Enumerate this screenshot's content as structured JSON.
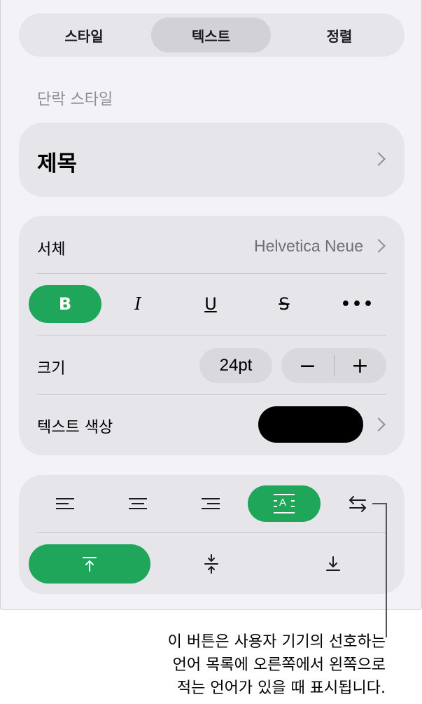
{
  "tabs": [
    {
      "label": "스타일",
      "active": false
    },
    {
      "label": "텍스트",
      "active": true
    },
    {
      "label": "정렬",
      "active": false
    }
  ],
  "paragraph_style": {
    "section_label": "단락 스타일",
    "value": "제목"
  },
  "font": {
    "label": "서체",
    "value": "Helvetica Neue"
  },
  "format_buttons": {
    "bold": "B",
    "italic": "I",
    "underline": "U",
    "strikethrough": "S",
    "more": "•••",
    "bold_active": true
  },
  "size": {
    "label": "크기",
    "value": "24pt",
    "decrement": "−",
    "increment": "+"
  },
  "text_color": {
    "label": "텍스트 색상",
    "color": "#000000"
  },
  "alignment": {
    "options": [
      "align-left",
      "align-center",
      "align-right",
      "justify",
      "right-to-left"
    ],
    "active": "justify",
    "justify_glyph": "A"
  },
  "vertical_alignment": {
    "top": "⊤",
    "middle": "middle",
    "bottom": "bottom",
    "active": "top"
  },
  "accent_color": "#1fa65a",
  "callout": {
    "line1": "이 버튼은 사용자 기기의 선호하는",
    "line2": "언어 목록에 오른쪽에서 왼쪽으로",
    "line3": "적는 언어가 있을 때 표시됩니다."
  }
}
